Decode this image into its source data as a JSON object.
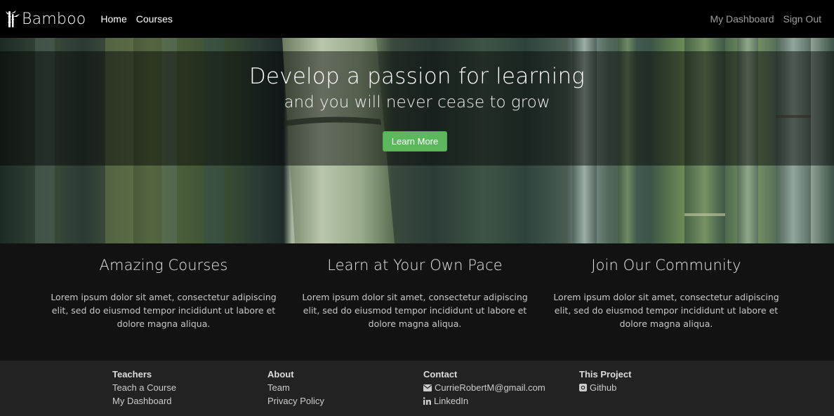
{
  "navbar": {
    "brand": "Bamboo",
    "links_left": [
      "Home",
      "Courses"
    ],
    "links_right": [
      "My Dashboard",
      "Sign Out"
    ]
  },
  "hero": {
    "title": "Develop a passion for learning",
    "subtitle": "and you will never cease to grow",
    "button": "Learn More",
    "button_color": "#5cb85c"
  },
  "features": [
    {
      "title": "Amazing Courses",
      "text": "Lorem ipsum dolor sit amet, consectetur adipiscing elit, sed do eiusmod tempor incididunt ut labore et dolore magna aliqua."
    },
    {
      "title": "Learn at Your Own Pace",
      "text": "Lorem ipsum dolor sit amet, consectetur adipiscing elit, sed do eiusmod tempor incididunt ut labore et dolore magna aliqua."
    },
    {
      "title": "Join Our Community",
      "text": "Lorem ipsum dolor sit amet, consectetur adipiscing elit, sed do eiusmod tempor incididunt ut labore et dolore magna aliqua."
    }
  ],
  "footer": {
    "teachers": {
      "heading": "Teachers",
      "links": [
        "Teach a Course",
        "My Dashboard"
      ]
    },
    "about": {
      "heading": "About",
      "links": [
        "Team",
        "Privacy Policy"
      ]
    },
    "contact": {
      "heading": "Contact",
      "email": "CurrieRobertM@gmail.com",
      "linkedin": "LinkedIn"
    },
    "project": {
      "heading": "This Project",
      "github": "Github"
    }
  }
}
